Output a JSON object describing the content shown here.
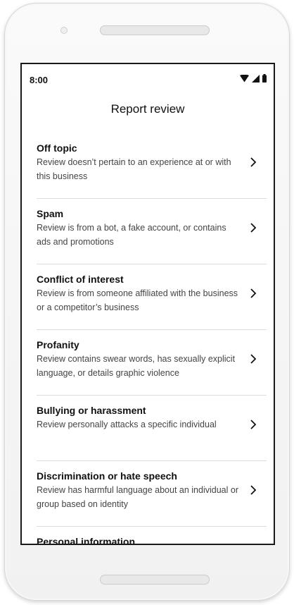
{
  "status": {
    "time": "8:00"
  },
  "header": {
    "title": "Report review"
  },
  "items": [
    {
      "title": "Off topic",
      "description": "Review doesn’t pertain to an experience at or with this business"
    },
    {
      "title": "Spam",
      "description": "Review is from a bot, a fake account, or contains ads and promotions"
    },
    {
      "title": "Conflict of interest",
      "description": "Review is from someone affiliated with the business or a competitor’s business"
    },
    {
      "title": "Profanity",
      "description": "Review contains swear words, has sexually explicit language, or details graphic violence"
    },
    {
      "title": "Bullying or harassment",
      "description": "Review personally attacks a specific individual"
    },
    {
      "title": "Discrimination or hate speech",
      "description": "Review has harmful language about an individual or group based on identity"
    },
    {
      "title": "Personal information",
      "description": ""
    }
  ],
  "icons": {
    "wifi": "wifi-icon",
    "signal": "signal-icon",
    "battery": "battery-icon",
    "chevron": "chevron-right-icon"
  }
}
